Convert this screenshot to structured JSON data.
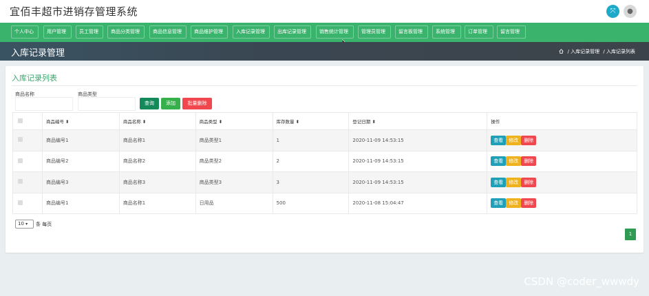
{
  "app": {
    "title": "宜佰丰超市进销存管理系统"
  },
  "header": {
    "expand_icon": "⤧",
    "user_icon": "●"
  },
  "nav": {
    "items": [
      {
        "label": "个人中心"
      },
      {
        "label": "用户管理"
      },
      {
        "label": "员工管理"
      },
      {
        "label": "商品分类管理"
      },
      {
        "label": "商品信息管理"
      },
      {
        "label": "商品维护管理"
      },
      {
        "label": "入库记录管理"
      },
      {
        "label": "出库记录管理"
      },
      {
        "label": "销售统计管理"
      },
      {
        "label": "管理员管理"
      },
      {
        "label": "留言板管理"
      },
      {
        "label": "系统管理"
      },
      {
        "label": "订单管理"
      },
      {
        "label": "留言管理"
      }
    ]
  },
  "page": {
    "title": "入库记录管理",
    "breadcrumb": [
      "/ 入库记录管理",
      "/ 入库记录列表"
    ]
  },
  "list": {
    "title": "入库记录列表",
    "filters": {
      "product_name_label": "商品名称",
      "product_name_value": "",
      "product_type_label": "商品类型",
      "product_type_value": ""
    },
    "buttons": {
      "search": "查询",
      "add": "添加",
      "batch_delete": "批量删除"
    },
    "columns": [
      "商品编号 ⬍",
      "商品名称 ⬍",
      "商品类型 ⬍",
      "库存数量 ⬍",
      "登记日期 ⬍",
      "操作"
    ],
    "rows": [
      {
        "code": "商品编号1",
        "name": "商品名称1",
        "type": "商品类型1",
        "qty": "1",
        "date": "2020-11-09 14:53:15"
      },
      {
        "code": "商品编号2",
        "name": "商品名称2",
        "type": "商品类型2",
        "qty": "2",
        "date": "2020-11-09 14:53:15"
      },
      {
        "code": "商品编号3",
        "name": "商品名称3",
        "type": "商品类型3",
        "qty": "3",
        "date": "2020-11-09 14:53:15"
      },
      {
        "code": "商品编号1",
        "name": "商品名称1",
        "type": "日用品",
        "qty": "500",
        "date": "2020-11-08 15:04:47"
      }
    ],
    "row_actions": {
      "view": "查看",
      "edit": "修改",
      "delete": "删除"
    },
    "page_size": "10",
    "page_size_label": "条 每页",
    "current_page": "1"
  },
  "watermark": "CSDN @coder_wwwdy",
  "colors": {
    "nav": "#3ab36d",
    "accent_title": "#3aa56b",
    "view": "#1fa0b8",
    "edit": "#f0b21c",
    "delete": "#f0484e",
    "pager": "#2f9a52"
  }
}
